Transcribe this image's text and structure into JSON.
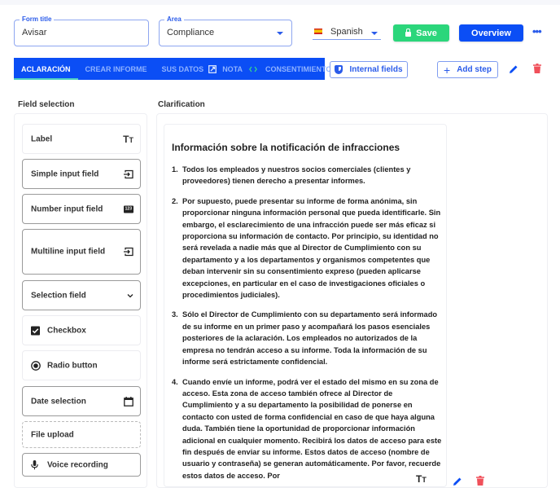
{
  "header": {
    "form_title": {
      "label": "Form title",
      "value": "Avisar"
    },
    "area": {
      "label": "Area",
      "value": "Compliance"
    },
    "language": {
      "value": "Spanish",
      "flag": "es-flag-icon"
    },
    "save_label": "Save",
    "overview_label": "Overview",
    "more_label": "•••"
  },
  "tabs": [
    {
      "label": "ACLARACIÓN",
      "active": true
    },
    {
      "label": "CREAR INFORME",
      "active": false
    },
    {
      "label": "SUS DATOS",
      "active": false
    },
    {
      "label": "NOTA",
      "active": false,
      "icon": "external-edit-icon"
    },
    {
      "label": "CONSENTIMIENTO",
      "active": false,
      "icon": "code-icon"
    }
  ],
  "toolbar": {
    "internal_fields_label": "Internal fields",
    "add_step_label": "Add step"
  },
  "field_selection": {
    "title": "Field selection",
    "items": [
      {
        "label": "Label",
        "icon": "text-size-icon"
      },
      {
        "label": "Simple input field",
        "icon": "input-icon"
      },
      {
        "label": "Number input field",
        "icon": "number-123-icon"
      },
      {
        "label": "Multiline input field",
        "icon": "input-icon"
      },
      {
        "label": "Selection field",
        "icon": "chevron-down-icon"
      },
      {
        "label": "Checkbox",
        "icon": "checkbox-icon"
      },
      {
        "label": "Radio button",
        "icon": "radio-icon"
      },
      {
        "label": "Date selection",
        "icon": "calendar-icon"
      },
      {
        "label": "File upload",
        "icon": ""
      },
      {
        "label": "Voice recording",
        "icon": "microphone-icon"
      }
    ]
  },
  "clarification": {
    "title": "Clarification",
    "card_title": "Información sobre la notificación de infracciones",
    "items": [
      {
        "num": "1.",
        "text": "Todos los empleados y nuestros socios comerciales (clientes y proveedores) tienen derecho a presentar informes."
      },
      {
        "num": "2.",
        "text": "Por supuesto, puede presentar su informe de forma anónima, sin proporcionar ninguna información personal que pueda identificarle. Sin embargo, el esclarecimiento de una infracción puede ser más eficaz si proporciona su información de contacto. Por principio, su identidad no será revelada a nadie más que al Director de Cumplimiento con su departamento y a los departamentos y organismos competentes que deban intervenir sin su consentimiento expreso (pueden aplicarse excepciones, en particular en el caso de investigaciones oficiales o procedimientos judiciales)."
      },
      {
        "num": "3.",
        "text": "Sólo el Director de Cumplimiento con su departamento será informado de su informe en un primer paso y acompañará los pasos esenciales posteriores de la aclaración. Los empleados no autorizados de la empresa no tendrán acceso a su informe. Toda la información de su informe será estrictamente confidencial."
      },
      {
        "num": "4.",
        "text": "Cuando envíe un informe, podrá ver el estado del mismo en su zona de acceso. Esta zona de acceso también ofrece al Director de Cumplimiento y a su departamento la posibilidad de ponerse en contacto con usted de forma confidencial en caso de que haya alguna duda. También tiene la oportunidad de proporcionar información adicional en cualquier momento. Recibirá los datos de acceso para este fin después de enviar su informe. Estos datos de acceso (nombre de usuario y contraseña) se generan automáticamente. Por favor, recuerde estos datos de acceso. Por"
      }
    ]
  },
  "colors": {
    "primary": "#0b4ef5",
    "save": "#2bd67b",
    "danger": "#f0505a",
    "tab_underline": "#4fd0c0"
  }
}
